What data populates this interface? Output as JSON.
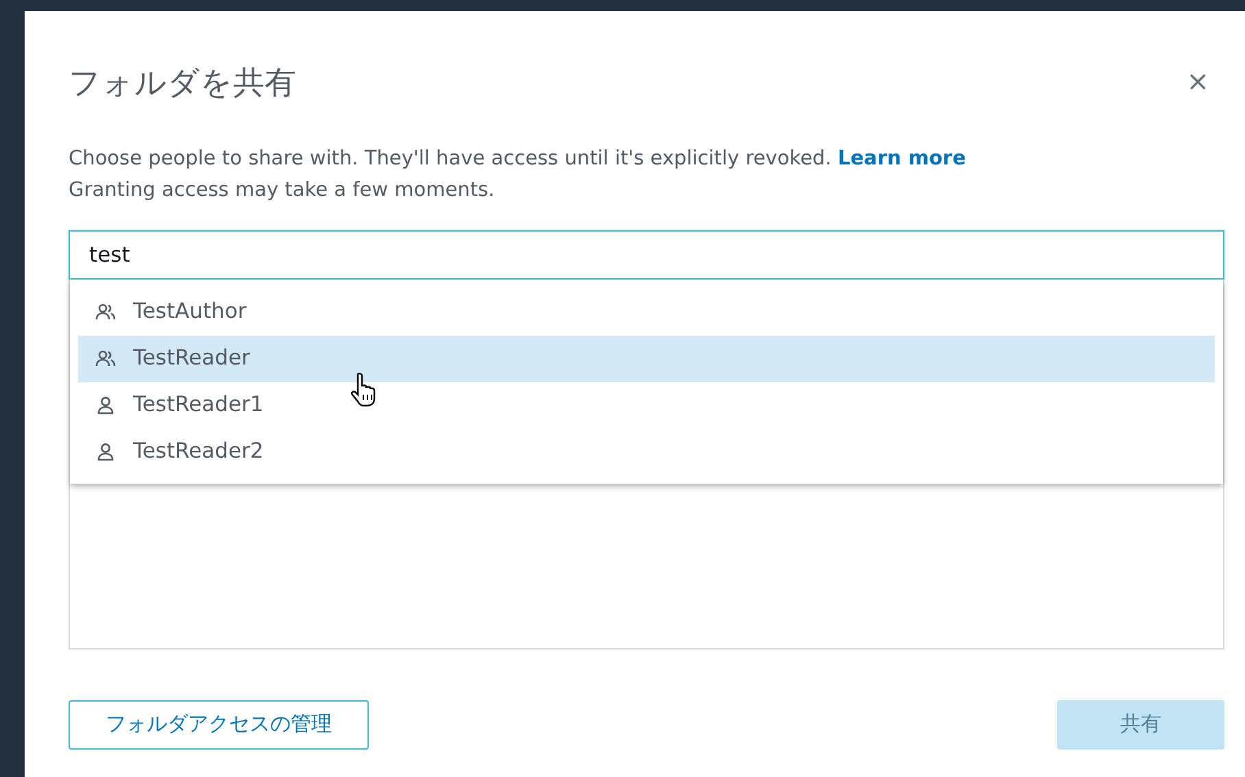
{
  "dialog": {
    "title": "フォルダを共有",
    "close": "×",
    "description": "Choose people to share with. They'll have access until it's explicitly revoked.",
    "learn_more": "Learn more",
    "note": "Granting access may take a few moments."
  },
  "search": {
    "value": "test"
  },
  "suggestions": [
    {
      "label": "TestAuthor",
      "kind": "group",
      "selected": false
    },
    {
      "label": "TestReader",
      "kind": "group",
      "selected": true
    },
    {
      "label": "TestReader1",
      "kind": "user",
      "selected": false
    },
    {
      "label": "TestReader2",
      "kind": "user",
      "selected": false
    }
  ],
  "buttons": {
    "manage": "フォルダアクセスの管理",
    "share": {
      "label": "共有",
      "disabled": true
    }
  }
}
